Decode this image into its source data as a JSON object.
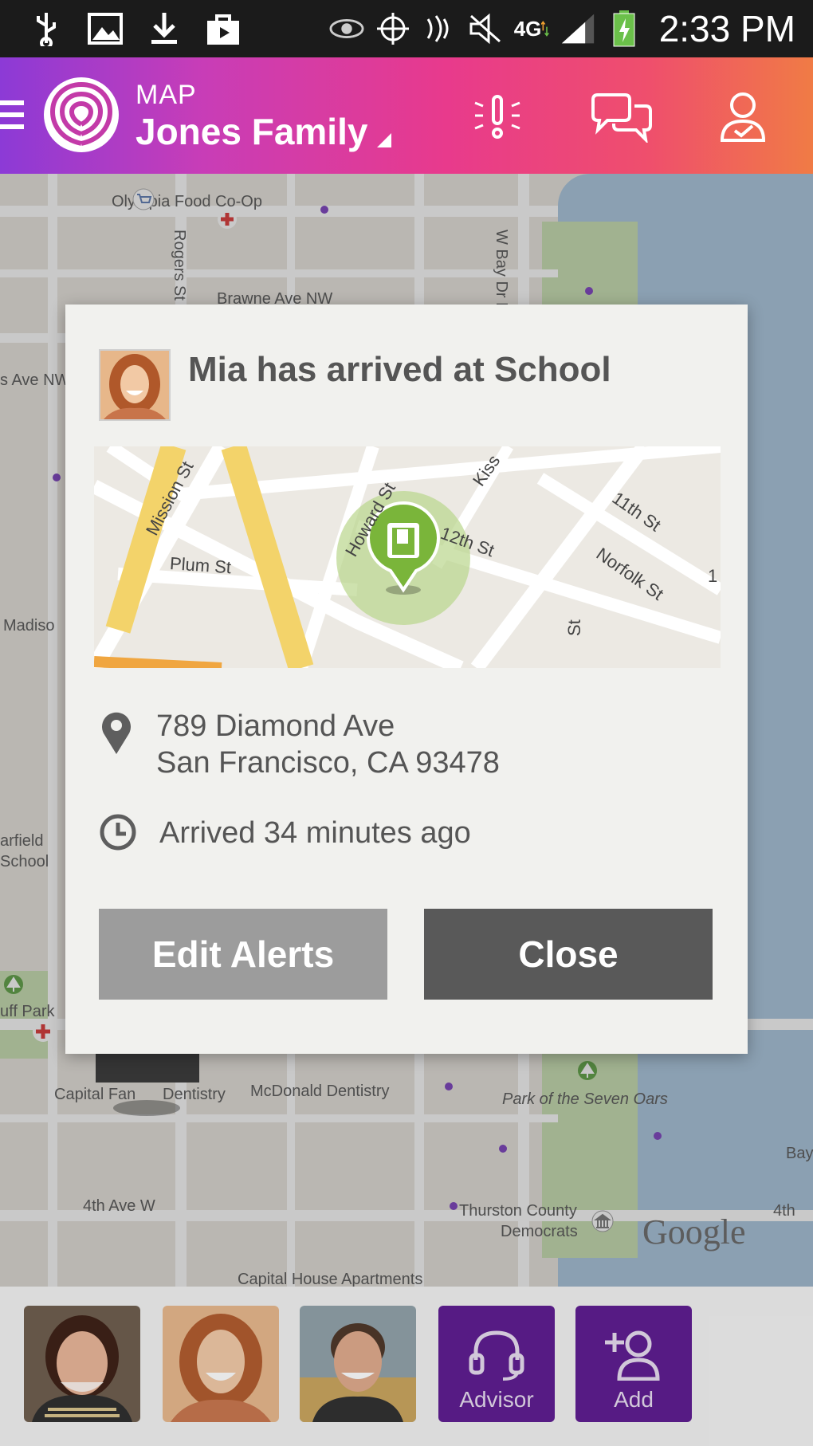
{
  "status_bar": {
    "time": "2:33 PM",
    "network": "4G"
  },
  "header": {
    "subtitle": "MAP",
    "title": "Jones Family"
  },
  "map": {
    "labels": [
      "Olympia Food Co-Op",
      "Brawne Ave NW",
      "s Ave NW",
      "W Bay Dr NW",
      "Rogers St NW",
      "Madiso",
      "arfield",
      "School",
      "uff Park",
      "Capital Fan",
      "Dentistry",
      "McDonald Dentistry",
      "Park of the Seven Oars",
      "Bay",
      "4th Ave W",
      "Thurston County",
      "Democrats",
      "4th",
      "Capital House Apartments"
    ],
    "attribution": "Google"
  },
  "modal": {
    "title": "Mia has arrived at School",
    "mini_map_labels": [
      "Mission St",
      "Howard St",
      "Kiss",
      "12th St",
      "11th St",
      "Norfolk St",
      "Plum St",
      "St",
      "1"
    ],
    "address_line1": "789 Diamond Ave",
    "address_line2": "San Francisco, CA 93478",
    "arrived": "Arrived 34 minutes ago",
    "edit_button": "Edit Alerts",
    "close_button": "Close"
  },
  "tray": {
    "advisor_label": "Advisor",
    "add_label": "Add"
  },
  "colors": {
    "header_gradient_start": "#8c3ad6",
    "header_gradient_end": "#f07b45",
    "tray_purple": "#5b178f",
    "geofence_green": "#7ab53a"
  }
}
